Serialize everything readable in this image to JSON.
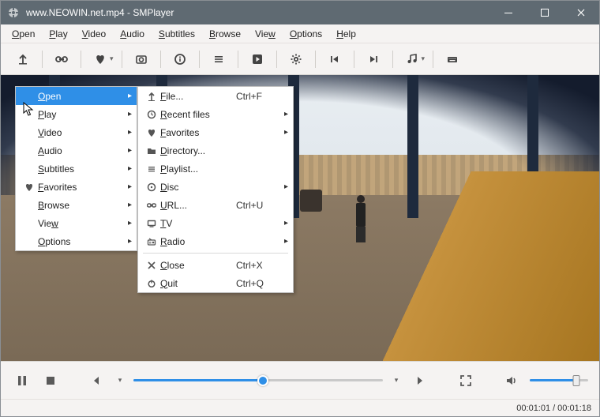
{
  "titlebar": {
    "title": "www.NEOWIN.net.mp4 - SMPlayer"
  },
  "menubar": {
    "items": [
      {
        "label": "Open",
        "accel": "O"
      },
      {
        "label": "Play",
        "accel": "P"
      },
      {
        "label": "Video",
        "accel": "V"
      },
      {
        "label": "Audio",
        "accel": "A"
      },
      {
        "label": "Subtitles",
        "accel": "S"
      },
      {
        "label": "Browse",
        "accel": "B"
      },
      {
        "label": "View",
        "accel": "V"
      },
      {
        "label": "Options",
        "accel": "O"
      },
      {
        "label": "Help",
        "accel": "H"
      }
    ]
  },
  "toolbar": {
    "items": [
      "open-file",
      "link",
      "favorite",
      "",
      "screenshot",
      "",
      "info",
      "playlist",
      "play-box",
      "",
      "settings",
      "",
      "prev-track",
      "next-track",
      "",
      "music",
      "keyboard"
    ]
  },
  "context1": {
    "items": [
      {
        "label": "Open",
        "accel": "O",
        "arrow": true,
        "selected": true
      },
      {
        "label": "Play",
        "accel": "P",
        "arrow": true
      },
      {
        "label": "Video",
        "accel": "V",
        "arrow": true
      },
      {
        "label": "Audio",
        "accel": "A",
        "arrow": true
      },
      {
        "label": "Subtitles",
        "accel": "S",
        "arrow": true
      },
      {
        "label": "Favorites",
        "accel": "F",
        "arrow": true,
        "icon": "heart"
      },
      {
        "label": "Browse",
        "accel": "B",
        "arrow": true
      },
      {
        "label": "View",
        "accel": "V",
        "arrow": true
      },
      {
        "label": "Options",
        "accel": "O",
        "arrow": true
      }
    ]
  },
  "context2": {
    "items": [
      {
        "icon": "file",
        "label": "File...",
        "accel": "F",
        "shortcut": "Ctrl+F"
      },
      {
        "icon": "recent",
        "label": "Recent files",
        "accel": "R",
        "arrow": true
      },
      {
        "icon": "heart",
        "label": "Favorites",
        "accel": "F",
        "arrow": true
      },
      {
        "icon": "folder",
        "label": "Directory...",
        "accel": "D"
      },
      {
        "icon": "playlist",
        "label": "Playlist...",
        "accel": "P"
      },
      {
        "icon": "disc",
        "label": "Disc",
        "accel": "D",
        "arrow": true
      },
      {
        "icon": "link",
        "label": "URL...",
        "accel": "U",
        "shortcut": "Ctrl+U"
      },
      {
        "icon": "tv",
        "label": "TV",
        "accel": "T",
        "arrow": true
      },
      {
        "icon": "radio",
        "label": "Radio",
        "accel": "R",
        "arrow": true
      },
      {
        "sep": true
      },
      {
        "icon": "close",
        "label": "Close",
        "accel": "C",
        "shortcut": "Ctrl+X"
      },
      {
        "icon": "power",
        "label": "Quit",
        "accel": "Q",
        "shortcut": "Ctrl+Q"
      }
    ]
  },
  "playback": {
    "seek_percent": 52,
    "volume_percent": 80
  },
  "status": {
    "current": "00:01:01",
    "sep": " / ",
    "total": "00:01:18"
  },
  "colors": {
    "accent": "#2f8fe7",
    "titlebar": "#5f6a72"
  }
}
